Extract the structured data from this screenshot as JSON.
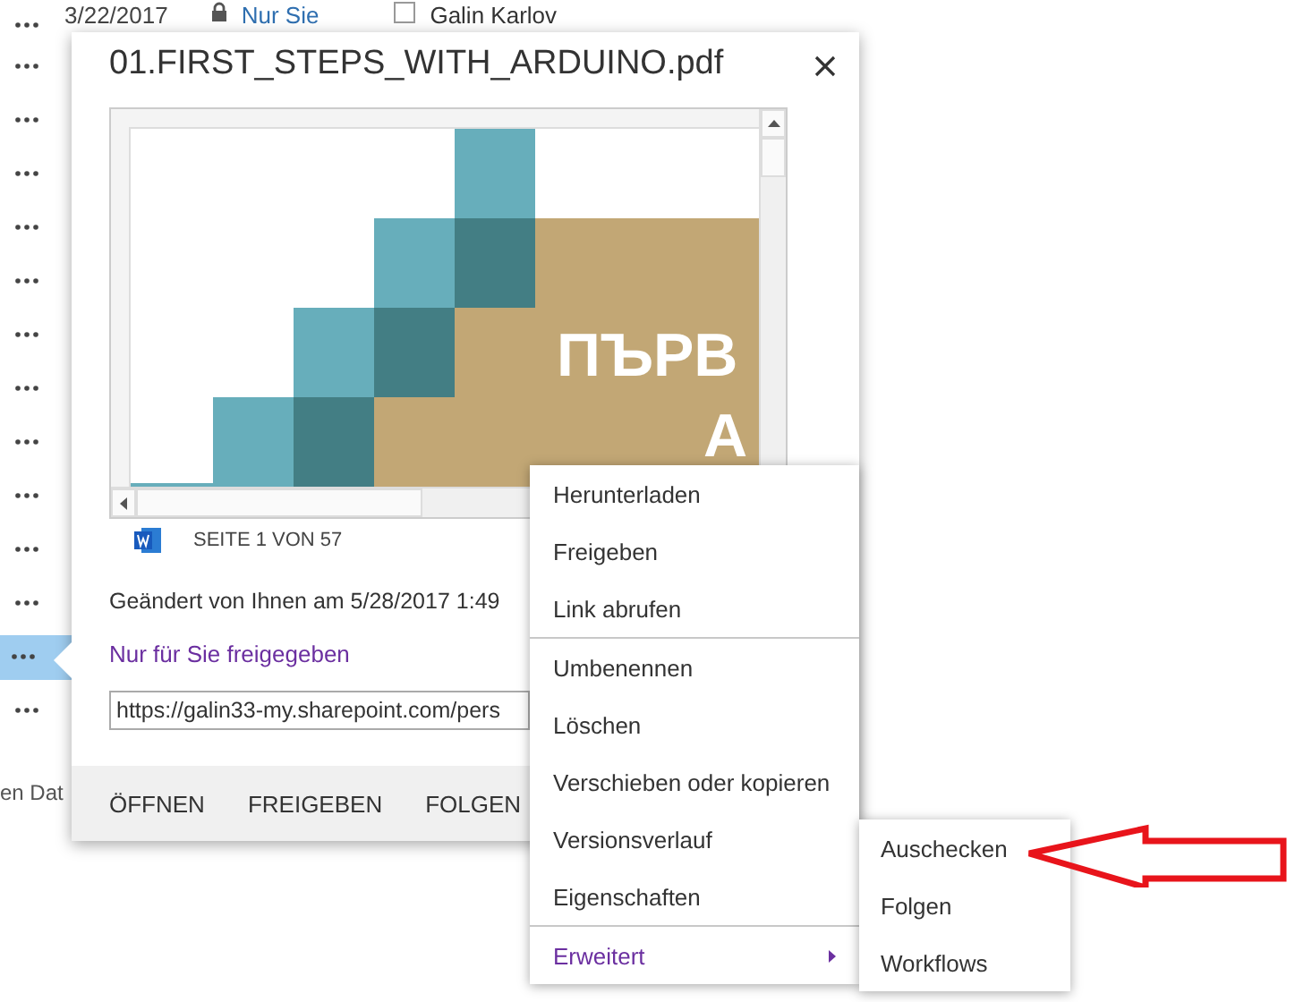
{
  "list_rows": [
    {
      "date": "3/22/2017",
      "sharing": "Nur Sie",
      "author": "Galin Karlov",
      "checked": false,
      "selected": false
    },
    {
      "selected": false
    },
    {
      "selected": false
    },
    {
      "selected": false
    },
    {
      "selected": false
    },
    {
      "selected": false
    },
    {
      "selected": false
    },
    {
      "selected": false
    },
    {
      "selected": false
    },
    {
      "selected": false
    },
    {
      "selected": false
    },
    {
      "selected": false
    },
    {
      "selected": true
    },
    {
      "selected": false
    }
  ],
  "list_footer": "en Dat",
  "callout": {
    "title": "01.FIRST_STEPS_WITH_ARDUINO.pdf",
    "preview": {
      "page_text": [
        "ПЪРВ",
        "А"
      ],
      "page_indicator": "SEITE 1 VON 57"
    },
    "modified": "Geändert von Ihnen am 5/28/2017 1:49",
    "shared_link": "Nur für Sie freigegeben",
    "url": "https://galin33-my.sharepoint.com/pers",
    "actions": [
      "ÖFFNEN",
      "FREIGEBEN",
      "FOLGEN"
    ]
  },
  "context_menu": {
    "groups": [
      [
        {
          "label": "Herunterladen",
          "kind": "item"
        },
        {
          "label": "Freigeben",
          "kind": "item"
        },
        {
          "label": "Link abrufen",
          "kind": "item"
        }
      ],
      [
        {
          "label": "Umbenennen",
          "kind": "item"
        },
        {
          "label": "Löschen",
          "kind": "item"
        },
        {
          "label": "Verschieben oder kopieren",
          "kind": "item"
        },
        {
          "label": "Versionsverlauf",
          "kind": "item"
        },
        {
          "label": "Eigenschaften",
          "kind": "item"
        }
      ],
      [
        {
          "label": "Erweitert",
          "kind": "submenu",
          "expanded": true,
          "children": [
            {
              "label": "Auschecken"
            },
            {
              "label": "Folgen"
            },
            {
              "label": "Workflows"
            }
          ]
        }
      ]
    ]
  }
}
